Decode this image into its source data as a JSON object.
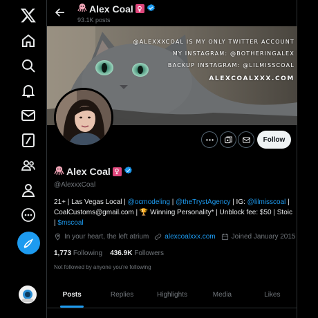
{
  "header": {
    "name": "Alex Coal",
    "post_count": "93.1K posts"
  },
  "banner": {
    "line1": "@alexxxcoal is my only twitter account",
    "line2": "my instagram: @botheringalex",
    "line3": "backup instagram: @lilmisscoal",
    "line4": "alexcoalxxx.com"
  },
  "actions": {
    "follow_label": "Follow"
  },
  "profile": {
    "name": "Alex Coal",
    "handle": "@AlexxxCoal",
    "bio": {
      "part1": "21+ | Las Vegas Local | ",
      "mention1": "@ocmodeling",
      "part2": " | ",
      "mention2": "@theTrystAgency",
      "part3": " | IG: ",
      "mention3": "@lilmisscoal",
      "part4": " | CoalCustoms@gmail.com | 🏆 Winning Personality* | Unblock fee: $50 | Stoic | ",
      "cashtag": "$mscoal"
    },
    "location": "In your heart, the left atrium",
    "website": "alexcoalxxx.com",
    "joined": "Joined January 2015",
    "following_count": "1,773",
    "following_label": "Following",
    "followers_count": "436.9K",
    "followers_label": "Followers",
    "not_followed": "Not followed by anyone you’re following"
  },
  "tabs": [
    "Posts",
    "Replies",
    "Highlights",
    "Media",
    "Likes"
  ],
  "colors": {
    "accent": "#1d9bf0",
    "background": "#000000",
    "text": "#e7e9ea",
    "muted": "#71767b",
    "flag_badge": "#e0467c"
  },
  "icons": {
    "sidebar": [
      "x-logo-icon",
      "home-icon",
      "search-icon",
      "notifications-icon",
      "messages-icon",
      "grok-icon",
      "communities-icon",
      "profile-icon",
      "more-icon",
      "post-icon"
    ],
    "name_decorations": [
      "octopus-emoji",
      "female-sign-emoji",
      "verified-badge-icon"
    ]
  }
}
